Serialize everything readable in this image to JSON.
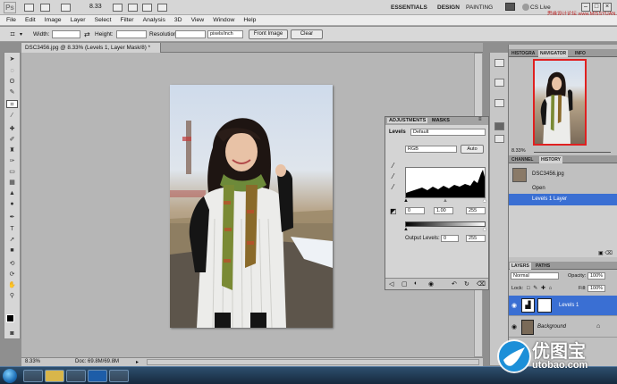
{
  "app": {
    "logo": "Ps",
    "zoom": "8.33",
    "workspaces": [
      "ESSENTIALS",
      "DESIGN",
      "PAINTING"
    ],
    "cs_live": "CS Live",
    "watermark_top": "思缘设计论坛 www.MISSYUAN.COM"
  },
  "menu": [
    "File",
    "Edit",
    "Image",
    "Layer",
    "Select",
    "Filter",
    "Analysis",
    "3D",
    "View",
    "Window",
    "Help"
  ],
  "options": {
    "width_label": "Width:",
    "height_label": "Height:",
    "resolution_label": "Resolution:",
    "resolution_unit": "pixels/inch",
    "front_image": "Front Image",
    "clear": "Clear"
  },
  "document": {
    "tab_title": "DSC3456.jpg @ 8.33% (Levels 1, Layer Mask/8) *",
    "zoom": "8.33%",
    "doc_info": "Doc: 69.8M/69.8M"
  },
  "adjustments": {
    "tabs": [
      "ADJUSTMENTS",
      "MASKS"
    ],
    "title": "Levels",
    "preset": "Default",
    "channel": "RGB",
    "auto": "Auto",
    "input_values": [
      "0",
      "1.00",
      "255"
    ],
    "output_label": "Output Levels:",
    "output_values": [
      "0",
      "255"
    ]
  },
  "navigator": {
    "tabs": [
      "HISTOGRA",
      "NAVIGATOR",
      "INFO"
    ],
    "zoom": "8.33%"
  },
  "history": {
    "tabs": [
      "CHANNEL",
      "HISTORY"
    ],
    "snapshot": "DSC3456.jpg",
    "items": [
      "Open",
      "Levels 1 Layer"
    ],
    "selected_index": 1
  },
  "layers": {
    "tabs": [
      "LAYERS",
      "PATHS"
    ],
    "blend_mode": "Normal",
    "opacity_label": "Opacity:",
    "opacity_value": "100%",
    "lock_label": "Lock:",
    "fill_label": "Fill:",
    "fill_value": "100%",
    "items": [
      {
        "name": "Levels 1",
        "selected": true
      },
      {
        "name": "Background",
        "selected": false
      }
    ]
  },
  "watermark_logo": {
    "cn": "优图宝",
    "url": "utobao.com"
  },
  "colors": {
    "selection": "#3a6fd3",
    "nav_frame": "#e02020"
  }
}
